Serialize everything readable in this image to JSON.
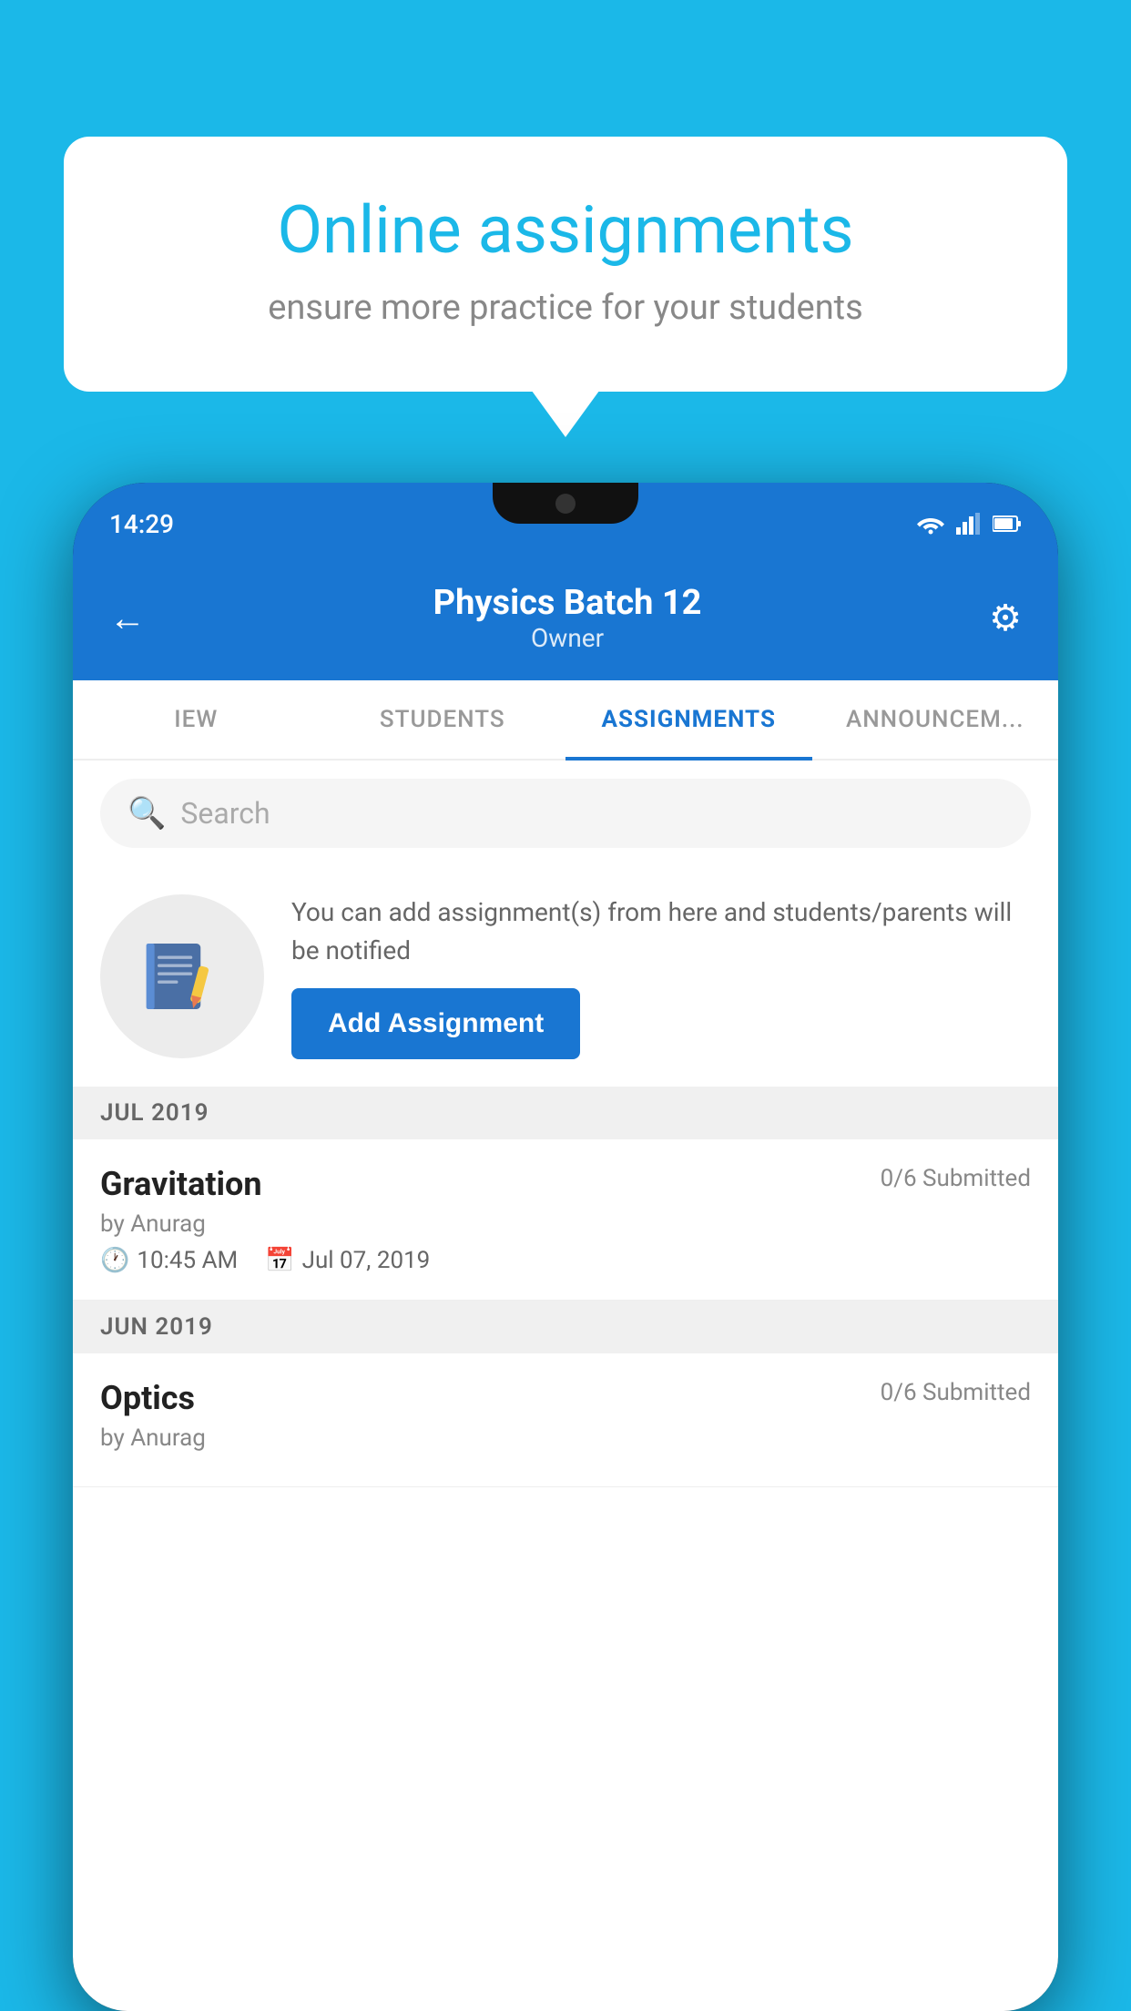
{
  "background_color": "#1BB8E8",
  "speech_bubble": {
    "title": "Online assignments",
    "subtitle": "ensure more practice for your students"
  },
  "phone": {
    "status_bar": {
      "time": "14:29",
      "icons": [
        "wifi",
        "signal",
        "battery"
      ]
    },
    "header": {
      "title": "Physics Batch 12",
      "subtitle": "Owner",
      "back_label": "←",
      "settings_label": "⚙"
    },
    "tabs": [
      {
        "label": "IEW",
        "active": false
      },
      {
        "label": "STUDENTS",
        "active": false
      },
      {
        "label": "ASSIGNMENTS",
        "active": true
      },
      {
        "label": "ANNOUNCEM...",
        "active": false
      }
    ],
    "search": {
      "placeholder": "Search"
    },
    "info_section": {
      "text": "You can add assignment(s) from here and students/parents will be notified",
      "button_label": "Add Assignment"
    },
    "sections": [
      {
        "label": "JUL 2019",
        "assignments": [
          {
            "name": "Gravitation",
            "submitted": "0/6 Submitted",
            "author": "by Anurag",
            "time": "10:45 AM",
            "date": "Jul 07, 2019"
          }
        ]
      },
      {
        "label": "JUN 2019",
        "assignments": [
          {
            "name": "Optics",
            "submitted": "0/6 Submitted",
            "author": "by Anurag",
            "time": "",
            "date": ""
          }
        ]
      }
    ]
  }
}
